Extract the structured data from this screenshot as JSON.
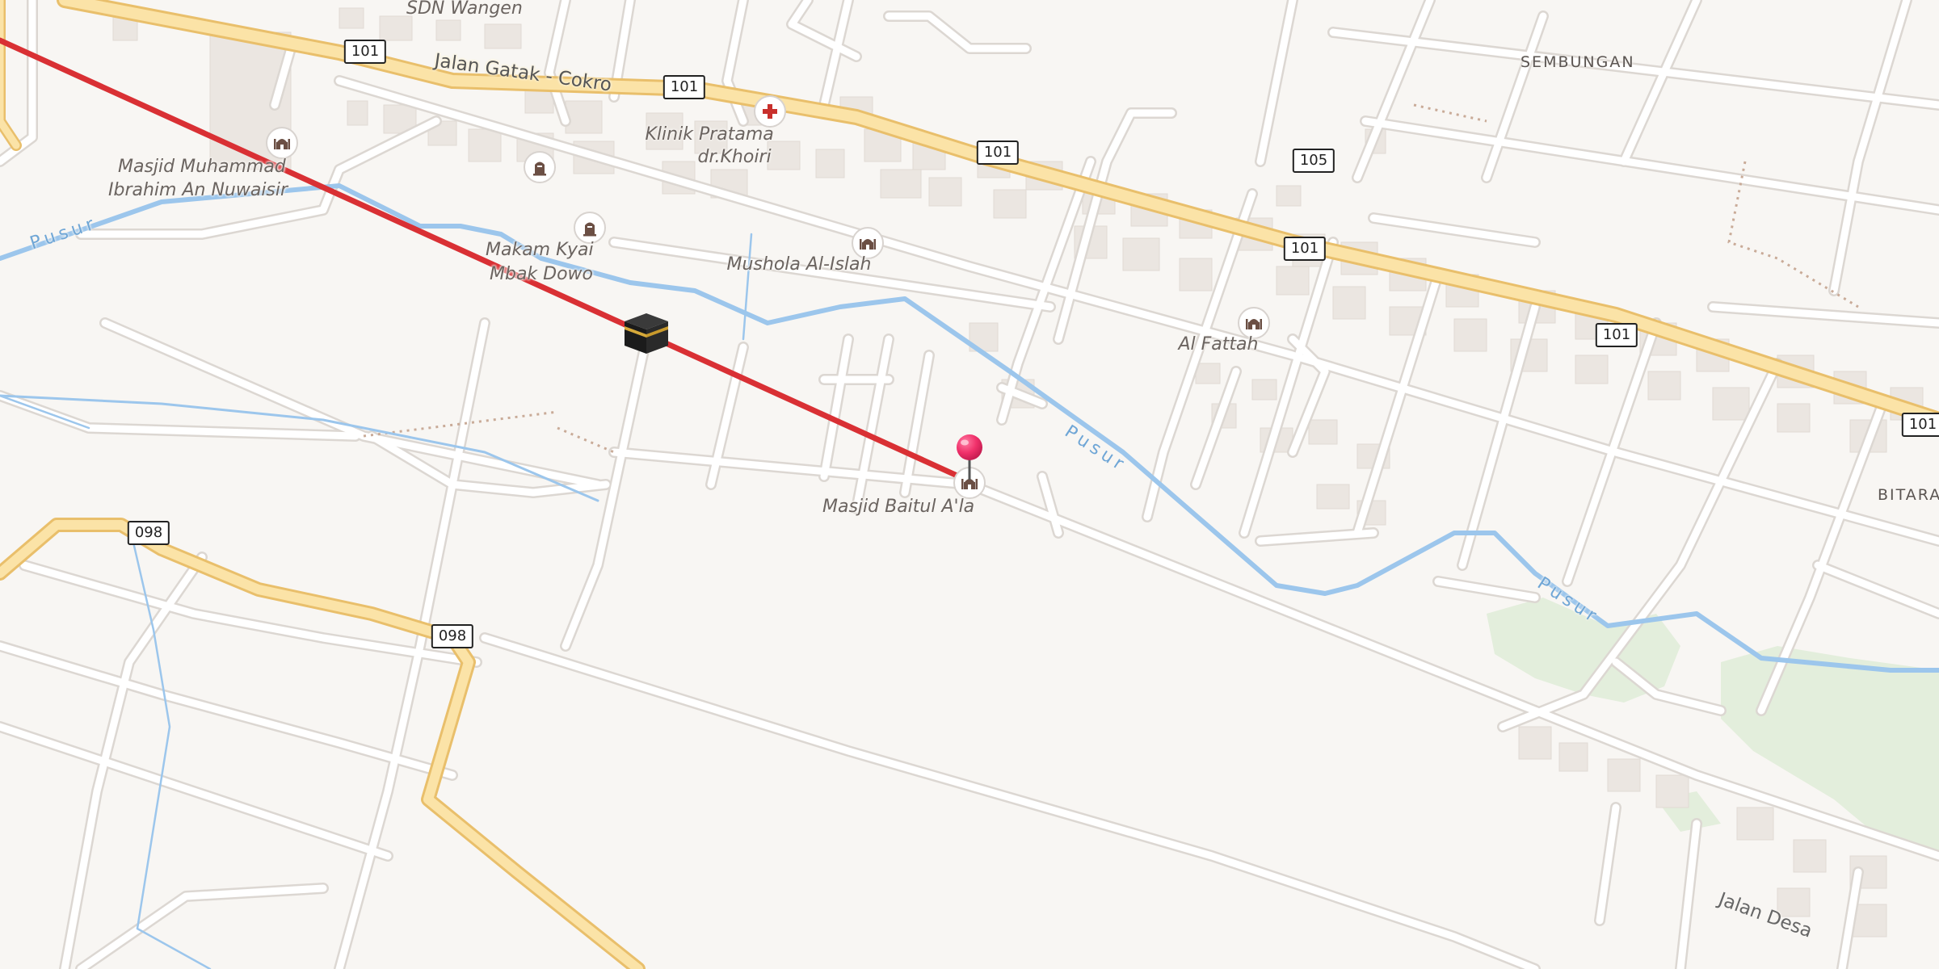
{
  "map": {
    "colors": {
      "background": "#f8f6f3",
      "minor_road": "#ffffff",
      "minor_road_casing": "#dcd7d2",
      "major_road": "#fbe3a7",
      "major_road_casing": "#e9bf6b",
      "water": "#9cc6ec",
      "building": "#ebe6e1",
      "park": "#e3eedc",
      "qibla_line": "#d93034",
      "pin": "#f0306a"
    },
    "area_labels": [
      {
        "id": "sembungan",
        "text": "SEMBUNGAN"
      },
      {
        "id": "bitara",
        "text": "BITARA"
      }
    ],
    "poi_labels": [
      {
        "id": "sdn-wangen",
        "text": "SDN Wangen"
      },
      {
        "id": "klinik-line1",
        "text": "Klinik Pratama"
      },
      {
        "id": "klinik-line2",
        "text": "dr.Khoiri"
      },
      {
        "id": "masjid-mi-line1",
        "text": "Masjid Muhammad"
      },
      {
        "id": "masjid-mi-line2",
        "text": "Ibrahim An Nuwaisir"
      },
      {
        "id": "makam-line1",
        "text": "Makam Kyai"
      },
      {
        "id": "makam-line2",
        "text": "Mbak Dowo"
      },
      {
        "id": "mushola",
        "text": "Mushola Al-Islah"
      },
      {
        "id": "al-fattah",
        "text": "Al Fattah"
      },
      {
        "id": "masjid-baitul",
        "text": "Masjid Baitul A'la"
      }
    ],
    "road_names": [
      {
        "id": "jalan-gatak",
        "text": "Jalan Gatak - Cokro"
      },
      {
        "id": "jalan-desa",
        "text": "Jalan Desa"
      }
    ],
    "waterway_names": [
      {
        "id": "pusur-1",
        "text": "Pusur"
      },
      {
        "id": "pusur-2",
        "text": "Pusur"
      },
      {
        "id": "pusur-3",
        "text": "Pusur"
      }
    ],
    "route_shields": [
      {
        "id": "s101a",
        "text": "101"
      },
      {
        "id": "s101b",
        "text": "101"
      },
      {
        "id": "s101c",
        "text": "101"
      },
      {
        "id": "s101d",
        "text": "101"
      },
      {
        "id": "s101e",
        "text": "101"
      },
      {
        "id": "s101f",
        "text": "101"
      },
      {
        "id": "s105",
        "text": "105"
      },
      {
        "id": "s098a",
        "text": "098"
      },
      {
        "id": "s098b",
        "text": "098"
      }
    ],
    "icons": {
      "mosque": "mosque-icon",
      "clinic": "medical-cross-icon",
      "cemetery": "cemetery-icon",
      "kaaba": "kaaba-icon",
      "pin": "location-pin-icon"
    }
  }
}
